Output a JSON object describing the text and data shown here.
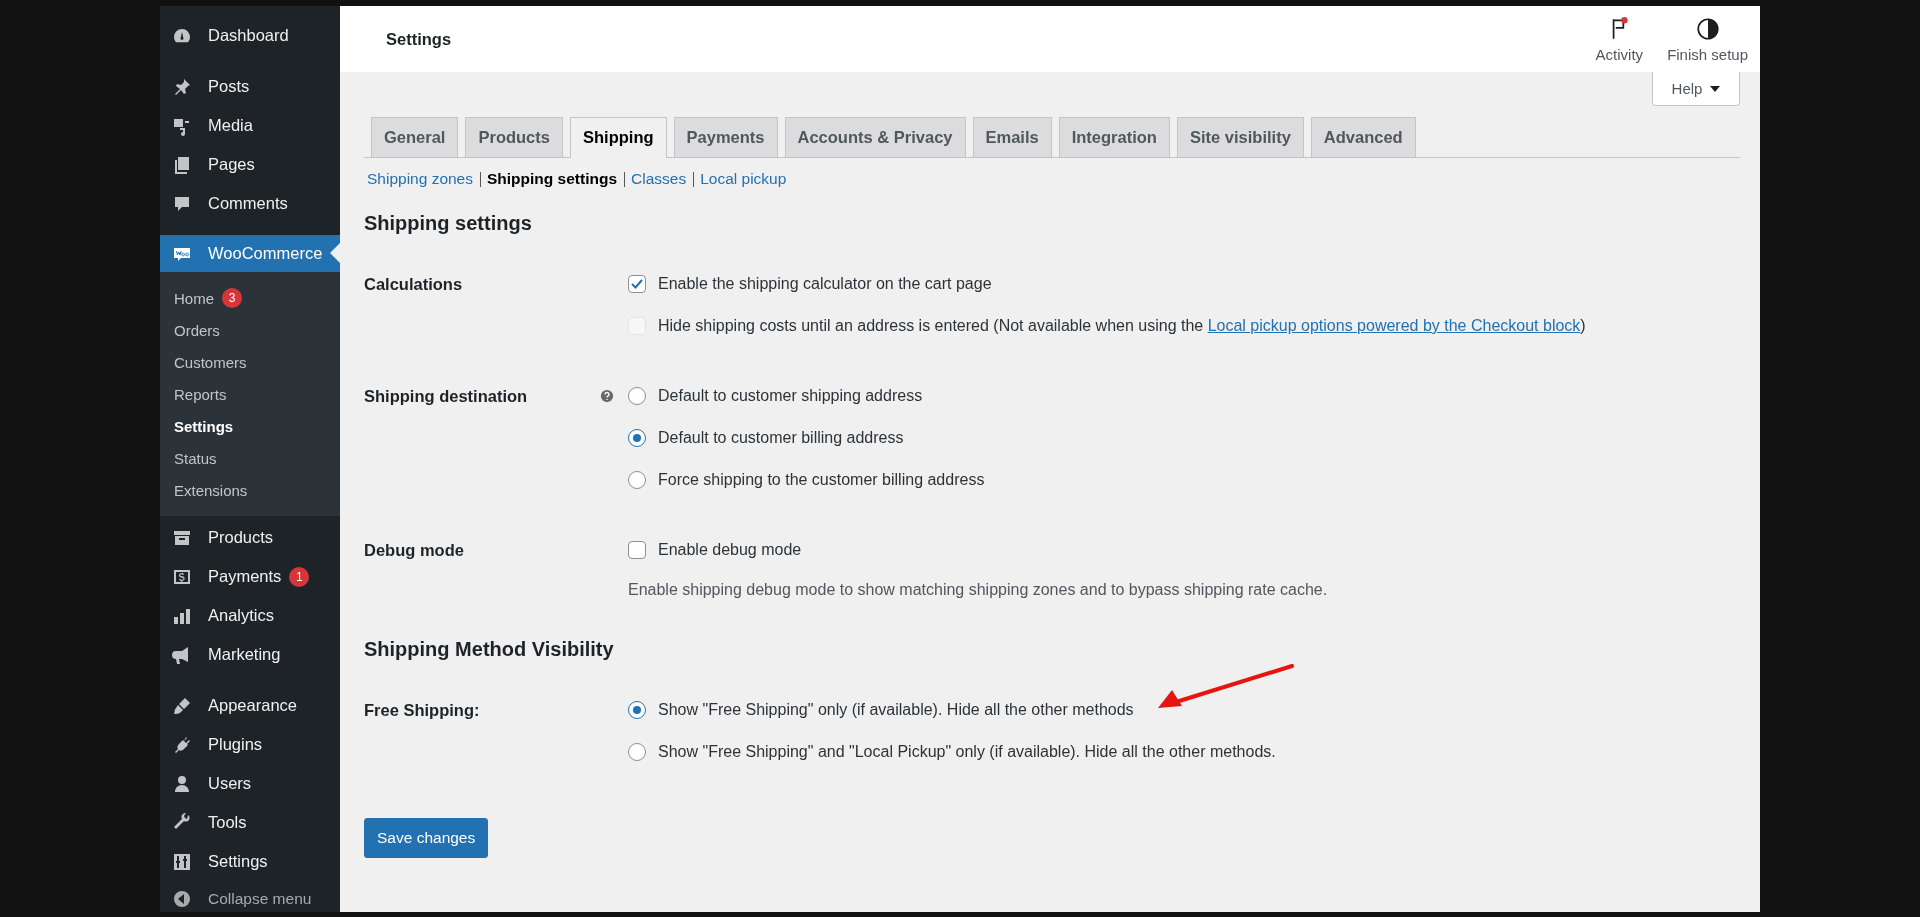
{
  "sidebar": {
    "groups": [
      [
        {
          "label": "Dashboard",
          "selected": false
        }
      ],
      [
        {
          "label": "Posts",
          "selected": false
        },
        {
          "label": "Media",
          "selected": false
        },
        {
          "label": "Pages",
          "selected": false
        },
        {
          "label": "Comments",
          "selected": false
        }
      ],
      [
        {
          "label": "WooCommerce",
          "selected": true,
          "children": [
            {
              "label": "Home",
              "badge": "3",
              "selected": false
            },
            {
              "label": "Orders",
              "selected": false
            },
            {
              "label": "Customers",
              "selected": false
            },
            {
              "label": "Reports",
              "selected": false
            },
            {
              "label": "Settings",
              "selected": true
            },
            {
              "label": "Status",
              "selected": false
            },
            {
              "label": "Extensions",
              "selected": false
            }
          ]
        },
        {
          "label": "Products",
          "selected": false
        },
        {
          "label": "Payments",
          "badge": "1",
          "selected": false
        },
        {
          "label": "Analytics",
          "selected": false
        },
        {
          "label": "Marketing",
          "selected": false
        }
      ],
      [
        {
          "label": "Appearance",
          "selected": false
        },
        {
          "label": "Plugins",
          "selected": false
        },
        {
          "label": "Users",
          "selected": false
        },
        {
          "label": "Tools",
          "selected": false
        },
        {
          "label": "Settings",
          "selected": false
        }
      ]
    ],
    "collapse": "Collapse menu"
  },
  "header": {
    "title": "Settings",
    "actions": [
      {
        "label": "Activity",
        "notification": true
      },
      {
        "label": "Finish setup",
        "notification": false
      }
    ]
  },
  "help_button": "Help",
  "tabs": [
    {
      "label": "General",
      "selected": false
    },
    {
      "label": "Products",
      "selected": false
    },
    {
      "label": "Shipping",
      "selected": true
    },
    {
      "label": "Payments",
      "selected": false
    },
    {
      "label": "Accounts & Privacy",
      "selected": false
    },
    {
      "label": "Emails",
      "selected": false
    },
    {
      "label": "Integration",
      "selected": false
    },
    {
      "label": "Site visibility",
      "selected": false
    },
    {
      "label": "Advanced",
      "selected": false
    }
  ],
  "subnav": [
    {
      "label": "Shipping zones",
      "selected": false
    },
    {
      "label": "Shipping settings",
      "selected": true
    },
    {
      "label": "Classes",
      "selected": false
    },
    {
      "label": "Local pickup",
      "selected": false
    }
  ],
  "sections": [
    {
      "title": "Shipping settings",
      "rows": [
        {
          "label": "Calculations",
          "help": false,
          "options": [
            {
              "kind": "checkbox",
              "text": "Enable the shipping calculator on the cart page",
              "checked": true,
              "disabled": false
            },
            {
              "kind": "checkbox",
              "text": "Hide shipping costs until an address is entered (Not available when using the ",
              "link": "Local pickup options powered by the Checkout block",
              "after": ")",
              "checked": false,
              "disabled": true
            }
          ]
        },
        {
          "label": "Shipping destination",
          "help": true,
          "options": [
            {
              "kind": "radio",
              "text": "Default to customer shipping address",
              "selected": false
            },
            {
              "kind": "radio",
              "text": "Default to customer billing address",
              "selected": true
            },
            {
              "kind": "radio",
              "text": "Force shipping to the customer billing address",
              "selected": false
            }
          ]
        },
        {
          "label": "Debug mode",
          "help": false,
          "options": [
            {
              "kind": "checkbox",
              "text": "Enable debug mode",
              "checked": false,
              "disabled": false
            }
          ],
          "description": "Enable shipping debug mode to show matching shipping zones and to bypass shipping rate cache."
        }
      ]
    },
    {
      "title": "Shipping Method Visibility",
      "rows": [
        {
          "label": "Free Shipping:",
          "help": false,
          "options": [
            {
              "kind": "radio",
              "text": "Show \"Free Shipping\" only (if available). Hide all the other methods",
              "selected": true
            },
            {
              "kind": "radio",
              "text": "Show \"Free Shipping\" and \"Local Pickup\" only (if available). Hide all the other methods.",
              "selected": false
            }
          ]
        }
      ]
    }
  ],
  "save_button": "Save changes"
}
